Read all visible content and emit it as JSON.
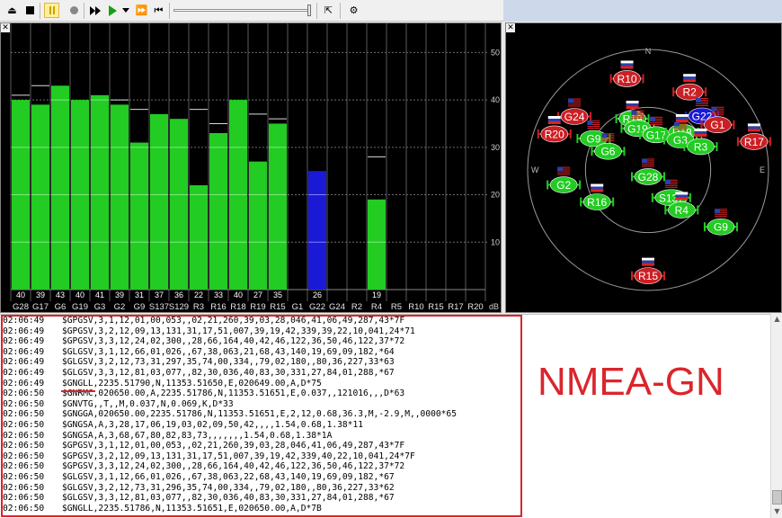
{
  "toolbar": {
    "icons": [
      "eject-icon",
      "stop-icon",
      "pause-icon",
      "record-icon",
      "play-icon",
      "play-dropdown-icon",
      "fast-forward-icon",
      "skip-to-start-icon",
      "expand-icon",
      "settings-icon"
    ],
    "pause_active": true
  },
  "snr_chart": {
    "y_ticks": [
      "50",
      "40",
      "30",
      "20",
      "10"
    ],
    "unit": "dB",
    "ymax": 55,
    "satellites": [
      {
        "id": "G28",
        "snr": 40,
        "label": "40",
        "prev": 41,
        "color": "green"
      },
      {
        "id": "G17",
        "snr": 39,
        "label": "39",
        "prev": 43,
        "color": "green"
      },
      {
        "id": "G6",
        "snr": 43,
        "label": "43",
        "prev": 43,
        "color": "green"
      },
      {
        "id": "G19",
        "snr": 40,
        "label": "40",
        "prev": 40,
        "color": "green"
      },
      {
        "id": "G3",
        "snr": 41,
        "label": "41",
        "prev": 41,
        "color": "green"
      },
      {
        "id": "G2",
        "snr": 39,
        "label": "39",
        "prev": 40,
        "color": "green"
      },
      {
        "id": "G9",
        "snr": 31,
        "label": "31",
        "prev": 38,
        "color": "green"
      },
      {
        "id": "S137",
        "snr": 37,
        "label": "37",
        "prev": 37,
        "color": "green"
      },
      {
        "id": "S129",
        "snr": 36,
        "label": "36",
        "prev": 36,
        "color": "green"
      },
      {
        "id": "R3",
        "snr": 22,
        "label": "22",
        "prev": 38,
        "color": "green"
      },
      {
        "id": "R16",
        "snr": 33,
        "label": "33",
        "prev": 35,
        "color": "green"
      },
      {
        "id": "R18",
        "snr": 40,
        "label": "40",
        "prev": 40,
        "color": "green"
      },
      {
        "id": "R19",
        "snr": 27,
        "label": "27",
        "prev": 37,
        "color": "green"
      },
      {
        "id": "R15",
        "snr": 35,
        "label": "35",
        "prev": 36,
        "color": "green"
      },
      {
        "id": "G1",
        "snr": 0,
        "label": "",
        "prev": 0,
        "color": "none"
      },
      {
        "id": "G22",
        "snr": 25,
        "label": "26",
        "prev": 0,
        "color": "blue"
      },
      {
        "id": "G24",
        "snr": 0,
        "label": "",
        "prev": 0,
        "color": "none"
      },
      {
        "id": "R2",
        "snr": 0,
        "label": "",
        "prev": 0,
        "color": "none"
      },
      {
        "id": "R4",
        "snr": 19,
        "label": "19",
        "prev": 28,
        "color": "green"
      },
      {
        "id": "R5",
        "snr": 0,
        "label": "",
        "prev": 0,
        "color": "none"
      },
      {
        "id": "R10",
        "snr": 0,
        "label": "",
        "prev": 0,
        "color": "none"
      },
      {
        "id": "R15",
        "snr": 0,
        "label": "",
        "prev": 0,
        "color": "none"
      },
      {
        "id": "R17",
        "snr": 0,
        "label": "",
        "prev": 0,
        "color": "none"
      },
      {
        "id": "R20",
        "snr": 0,
        "label": "",
        "prev": 0,
        "color": "none"
      }
    ]
  },
  "sky_plot": {
    "directions": {
      "n": "N",
      "w": "W",
      "e": "E"
    },
    "satellites": [
      {
        "id": "R10",
        "color": "red",
        "az": 347,
        "el": 70
      },
      {
        "id": "R2",
        "color": "red",
        "az": 28,
        "el": 66
      },
      {
        "id": "G22",
        "color": "blue",
        "az": 45,
        "el": 57
      },
      {
        "id": "G1",
        "color": "red",
        "az": 57,
        "el": 62
      },
      {
        "id": "R19",
        "color": "green",
        "az": 343,
        "el": 40
      },
      {
        "id": "G19",
        "color": "green",
        "az": 346,
        "el": 32
      },
      {
        "id": "G17",
        "color": "green",
        "az": 13,
        "el": 27
      },
      {
        "id": "R18",
        "color": "green",
        "az": 42,
        "el": 38
      },
      {
        "id": "G3",
        "color": "green",
        "az": 47,
        "el": 33
      },
      {
        "id": "G24",
        "color": "red",
        "az": 306,
        "el": 68
      },
      {
        "id": "R20",
        "color": "red",
        "az": 291,
        "el": 75
      },
      {
        "id": "G9",
        "color": "green",
        "az": 300,
        "el": 47
      },
      {
        "id": "R3",
        "color": "green",
        "az": 66,
        "el": 43
      },
      {
        "id": "R17",
        "color": "red",
        "az": 75,
        "el": 82
      },
      {
        "id": "G6",
        "color": "green",
        "az": 295,
        "el": 33
      },
      {
        "id": "G2",
        "color": "green",
        "az": 260,
        "el": 64
      },
      {
        "id": "G28",
        "color": "green",
        "az": 180,
        "el": 5
      },
      {
        "id": "S137",
        "color": "green",
        "az": 140,
        "el": 27
      },
      {
        "id": "R16",
        "color": "green",
        "az": 238,
        "el": 45
      },
      {
        "id": "R4",
        "color": "green",
        "az": 140,
        "el": 39
      },
      {
        "id": "G9",
        "color": "green",
        "az": 128,
        "el": 69
      },
      {
        "id": "R15",
        "color": "red",
        "az": 180,
        "el": 79
      }
    ]
  },
  "log": {
    "lines": [
      {
        "time": "02:06:49",
        "text": "$GPGSV,3,1,12,01,00,053,,02,21,260,39,03,28,046,41,06,49,287,43*7F"
      },
      {
        "time": "02:06:49",
        "text": "$GPGSV,3,2,12,09,13,131,31,17,51,007,39,19,42,339,39,22,10,041,24*71"
      },
      {
        "time": "02:06:49",
        "text": "$GPGSV,3,3,12,24,02,300,,28,66,164,40,42,46,122,36,50,46,122,37*72"
      },
      {
        "time": "02:06:49",
        "text": "$GLGSV,3,1,12,66,01,026,,67,38,063,21,68,43,140,19,69,09,182,*64"
      },
      {
        "time": "02:06:49",
        "text": "$GLGSV,3,2,12,73,31,297,35,74,00,334,,79,02,180,,80,36,227,33*63"
      },
      {
        "time": "02:06:49",
        "text": "$GLGSV,3,3,12,81,03,077,,82,30,036,40,83,30,331,27,84,01,288,*67"
      },
      {
        "time": "02:06:49",
        "text": "$GNGLL,2235.51790,N,11353.51650,E,020649.00,A,D*75"
      },
      {
        "time": "02:06:50",
        "text": "$GNRMC,020650.00,A,2235.51786,N,11353.51651,E,0.037,,121016,,,D*63"
      },
      {
        "time": "02:06:50",
        "text": "$GNVTG,,T,,M,0.037,N,0.069,K,D*33"
      },
      {
        "time": "02:06:50",
        "text": "$GNGGA,020650.00,2235.51786,N,11353.51651,E,2,12,0.68,36.3,M,-2.9,M,,0000*65"
      },
      {
        "time": "02:06:50",
        "text": "$GNGSA,A,3,28,17,06,19,03,02,09,50,42,,,,1.54,0.68,1.38*11"
      },
      {
        "time": "02:06:50",
        "text": "$GNGSA,A,3,68,67,80,82,83,73,,,,,,,1.54,0.68,1.38*1A"
      },
      {
        "time": "02:06:50",
        "text": "$GPGSV,3,1,12,01,00,053,,02,21,260,39,03,28,046,41,06,49,287,43*7F"
      },
      {
        "time": "02:06:50",
        "text": "$GPGSV,3,2,12,09,13,131,31,17,51,007,39,19,42,339,40,22,10,041,24*7F"
      },
      {
        "time": "02:06:50",
        "text": "$GPGSV,3,3,12,24,02,300,,28,66,164,40,42,46,122,36,50,46,122,37*72"
      },
      {
        "time": "02:06:50",
        "text": "$GLGSV,3,1,12,66,01,026,,67,38,063,22,68,43,140,19,69,09,182,*67"
      },
      {
        "time": "02:06:50",
        "text": "$GLGSV,3,2,12,73,31,296,35,74,00,334,,79,02,180,,80,36,227,33*62"
      },
      {
        "time": "02:06:50",
        "text": "$GLGSV,3,3,12,81,03,077,,82,30,036,40,83,30,331,27,84,01,288,*67"
      },
      {
        "time": "02:06:50",
        "text": "$GNGLL,2235.51786,N,11353.51651,E,020650.00,A,D*7B"
      }
    ]
  },
  "annotation": "NMEA-GN",
  "colors": {
    "green": "#22cc22",
    "blue": "#1a1ad6",
    "red": "#cc1f24",
    "annotation": "#d9262c"
  }
}
